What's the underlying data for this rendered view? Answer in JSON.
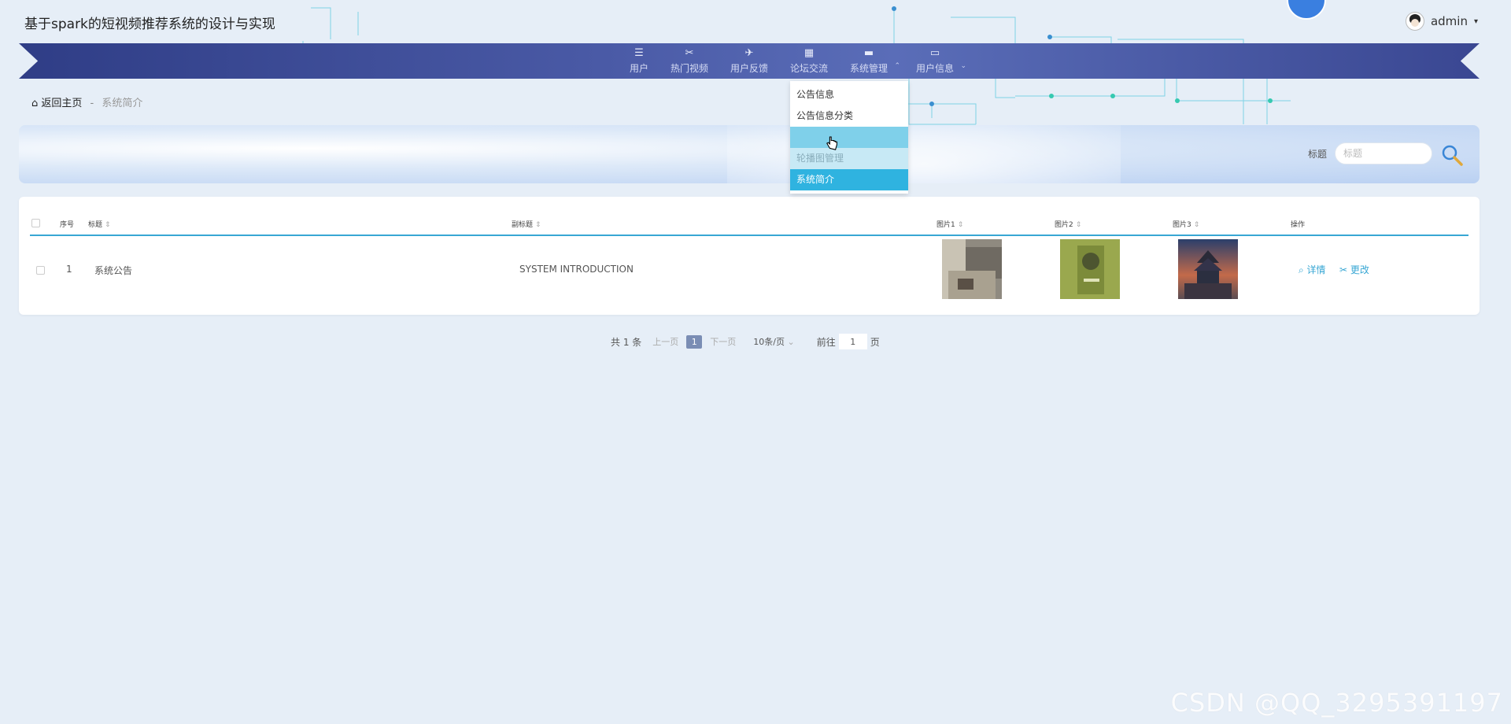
{
  "app": {
    "title": "基于spark的短视频推荐系统的设计与实现"
  },
  "user": {
    "name": "admin",
    "caret": "▾"
  },
  "nav": {
    "items": [
      {
        "label": "用户",
        "icon": "list-icon",
        "glyph": "☰"
      },
      {
        "label": "热门视频",
        "icon": "ticket-icon",
        "glyph": "✂"
      },
      {
        "label": "用户反馈",
        "icon": "paper-plane-icon",
        "glyph": "✈"
      },
      {
        "label": "论坛交流",
        "icon": "grid-icon",
        "glyph": "▦"
      },
      {
        "label": "系统管理",
        "icon": "server-icon",
        "glyph": "▬",
        "arrow": "⌃"
      },
      {
        "label": "用户信息",
        "icon": "card-icon",
        "glyph": "▭",
        "arrow": "⌄"
      }
    ]
  },
  "dropdown": {
    "items": [
      {
        "label": "公告信息"
      },
      {
        "label": "公告信息分类"
      },
      {
        "label": ""
      },
      {
        "label": "轮播图管理"
      },
      {
        "label": "系统简介"
      }
    ]
  },
  "breadcrumb": {
    "home": "返回主页",
    "sep": "-",
    "current": "系统简介"
  },
  "search": {
    "label": "标题",
    "placeholder": "标题",
    "value": ""
  },
  "table": {
    "columns": [
      "序号",
      "标题",
      "副标题",
      "图片1",
      "图片2",
      "图片3",
      "操作"
    ],
    "rows": [
      {
        "index": "1",
        "title": "系统公告",
        "subtitle": "SYSTEM INTRODUCTION",
        "detail": "详情",
        "edit": "更改"
      }
    ]
  },
  "pager": {
    "total": "共 1 条",
    "prev": "上一页",
    "current": "1",
    "next": "下一页",
    "page_size": "10条/页",
    "goto_prefix": "前往",
    "goto_value": "1",
    "goto_suffix": "页"
  },
  "watermark": "CSDN @QQ_3295391197",
  "colors": {
    "accent": "#38a7d4",
    "nav_dark": "#2f3d86",
    "dropdown_active": "#2fb3e0"
  }
}
